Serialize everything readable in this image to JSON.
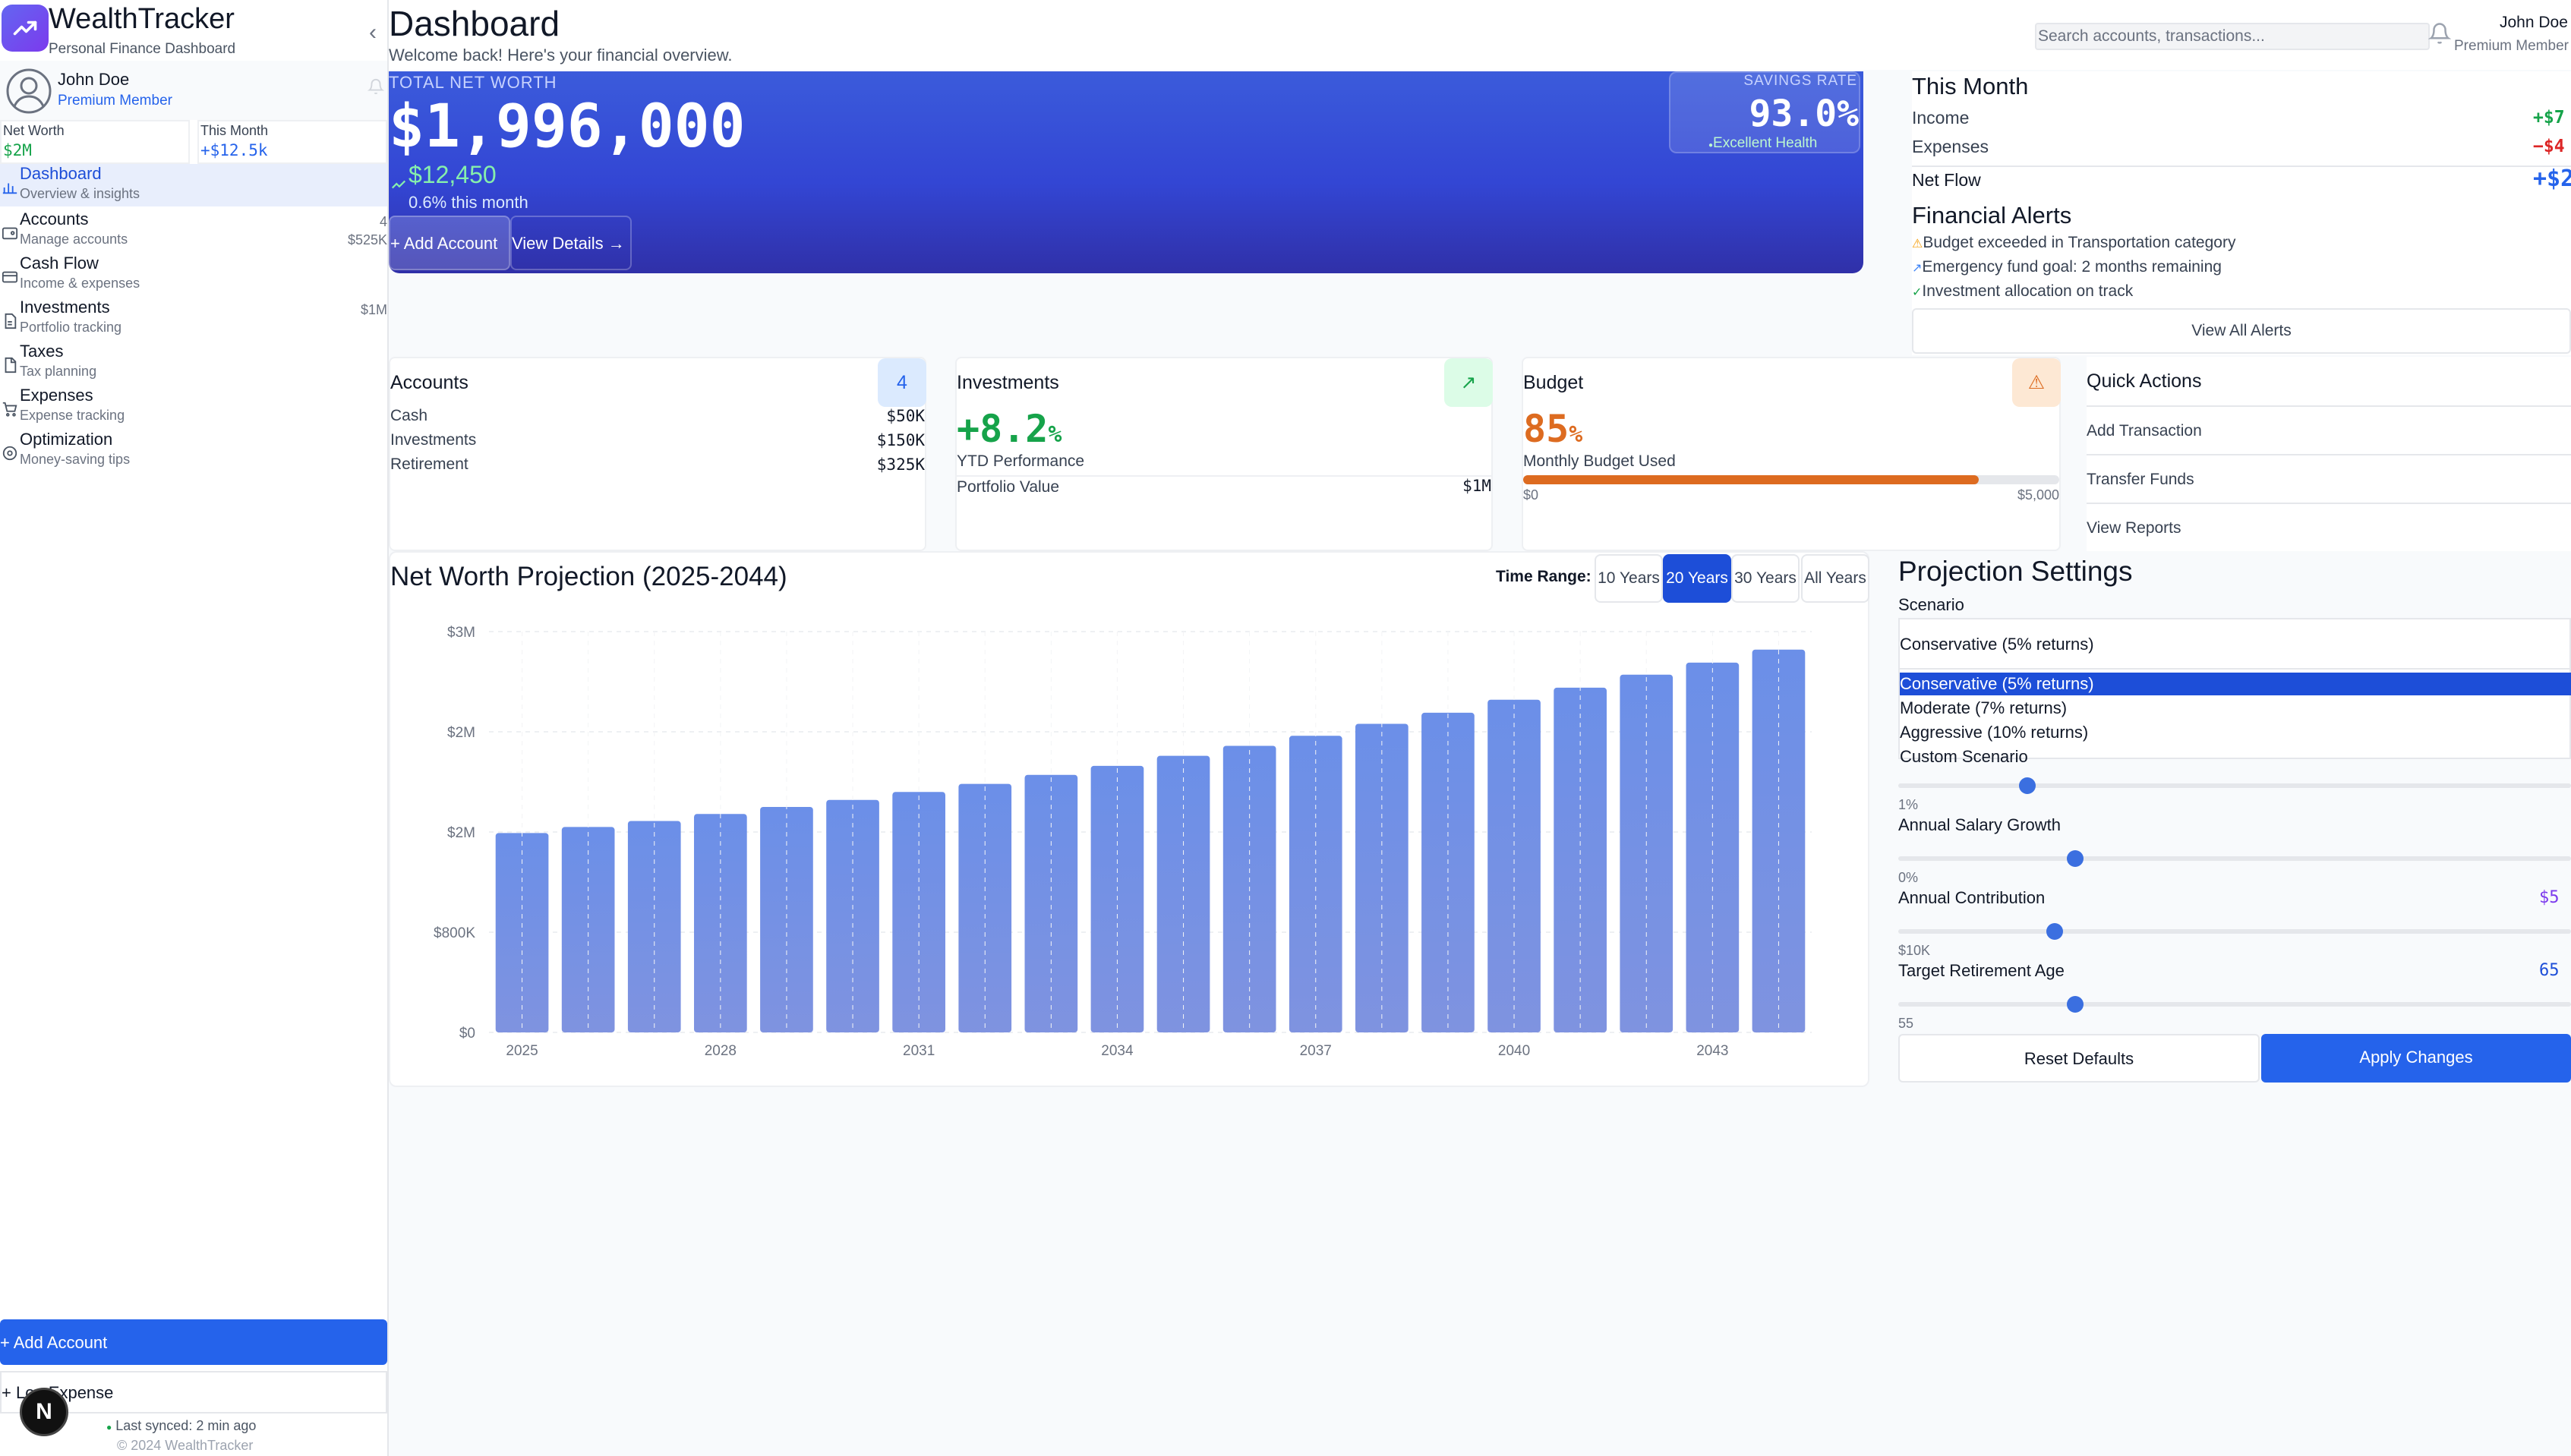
{
  "app": {
    "name": "WealthTracker",
    "tagline": "Personal Finance Dashboard"
  },
  "user": {
    "name": "John Doe",
    "membership": "Premium Member",
    "top_name": "John Doe",
    "top_membership": "Premium Member"
  },
  "sidebar": {
    "summary": [
      {
        "label": "Net Worth",
        "value": "$2M"
      },
      {
        "label": "This Month",
        "value": "+$12.5k"
      }
    ],
    "items": [
      {
        "label": "Dashboard",
        "sub": "Overview & insights",
        "count": "",
        "amount": "",
        "icon": "bar-chart-icon"
      },
      {
        "label": "Accounts",
        "sub": "Manage accounts",
        "count": "4",
        "amount": "$525K",
        "icon": "wallet-icon"
      },
      {
        "label": "Cash Flow",
        "sub": "Income & expenses",
        "count": "",
        "amount": "",
        "icon": "credit-card-icon"
      },
      {
        "label": "Investments",
        "sub": "Portfolio tracking",
        "count": "",
        "amount": "$1M",
        "icon": "document-icon"
      },
      {
        "label": "Taxes",
        "sub": "Tax planning",
        "count": "",
        "amount": "",
        "icon": "file-icon"
      },
      {
        "label": "Expenses",
        "sub": "Expense tracking",
        "count": "",
        "amount": "",
        "icon": "cart-icon"
      },
      {
        "label": "Optimization",
        "sub": "Money-saving tips",
        "count": "",
        "amount": "",
        "icon": "target-icon"
      }
    ],
    "add_account": "+ Add Account",
    "log_expense": "+ Log Expense",
    "last_synced": "Last synced: 2 min ago",
    "copyright": "© 2024 WealthTracker",
    "badge_letter": "N"
  },
  "header": {
    "title": "Dashboard",
    "subtitle": "Welcome back! Here's your financial overview.",
    "search_placeholder": "Search accounts, transactions..."
  },
  "hero": {
    "label": "TOTAL NET WORTH",
    "value": "$1,996,000",
    "change": "$12,450",
    "change_pct": "0.6% this month",
    "add_account": "+ Add Account",
    "view_details": "View Details",
    "savings_label": "SAVINGS RATE",
    "savings_value": "93.0%",
    "savings_health": "Excellent Health"
  },
  "this_month": {
    "title": "This Month",
    "rows": [
      {
        "label": "Income",
        "value": "+$7",
        "color": "#16a34a"
      },
      {
        "label": "Expenses",
        "value": "−$4",
        "color": "#dc2626"
      },
      {
        "label": "Net Flow",
        "value": "+$2,",
        "color": "#2563eb"
      }
    ]
  },
  "alerts": {
    "title": "Financial Alerts",
    "items": [
      {
        "text": "Budget exceeded in Transportation category",
        "icon": "warning-icon",
        "color": "#f59e0b"
      },
      {
        "text": "Emergency fund goal: 2 months remaining",
        "icon": "trend-icon",
        "color": "#3b82f6"
      },
      {
        "text": "Investment allocation on track",
        "icon": "check-circle-icon",
        "color": "#16a34a"
      }
    ],
    "view_all": "View All Alerts"
  },
  "cards": {
    "accounts": {
      "title": "Accounts",
      "badge": "4",
      "rows": [
        {
          "label": "Cash",
          "value": "$50K"
        },
        {
          "label": "Investments",
          "value": "$150K"
        },
        {
          "label": "Retirement",
          "value": "$325K"
        }
      ]
    },
    "investments": {
      "title": "Investments",
      "big": "+8.2",
      "big_suffix": "%",
      "caption": "YTD Performance",
      "row_label": "Portfolio Value",
      "row_value": "$1M"
    },
    "budget": {
      "title": "Budget",
      "big": "85",
      "big_suffix": "%",
      "caption": "Monthly Budget Used",
      "progress": 0.85,
      "min": "$0",
      "max": "$5,000"
    }
  },
  "quick_actions": {
    "title": "Quick Actions",
    "items": [
      "Add Transaction",
      "Transfer Funds",
      "View Reports"
    ]
  },
  "projection": {
    "title": "Net Worth Projection (2025-2044)",
    "time_range_label": "Time Range:",
    "ranges": [
      "10 Years",
      "20 Years",
      "30 Years",
      "All Years"
    ],
    "active_range": "20 Years"
  },
  "chart_data": {
    "type": "bar",
    "categories": [
      "2025",
      "2026",
      "2027",
      "2028",
      "2029",
      "2030",
      "2031",
      "2032",
      "2033",
      "2034",
      "2035",
      "2036",
      "2037",
      "2038",
      "2039",
      "2040",
      "2041",
      "2042",
      "2043",
      "2044"
    ],
    "values": [
      1990000,
      2050000,
      2110000,
      2180000,
      2250000,
      2320000,
      2400000,
      2480000,
      2570000,
      2660000,
      2760000,
      2860000,
      2960000,
      3080000,
      3190000,
      3320000,
      3440000,
      3570000,
      3690000,
      3820000
    ],
    "x_tick_labels": [
      "2025",
      "2028",
      "2031",
      "2034",
      "2037",
      "2040",
      "2043"
    ],
    "y_ticks": [
      {
        "value": 0,
        "label": "$0"
      },
      {
        "value": 1000000,
        "label": "$800K"
      },
      {
        "value": 2000000,
        "label": "$2M"
      },
      {
        "value": 3000000,
        "label": "$2M"
      },
      {
        "value": 4000000,
        "label": "$3M"
      }
    ],
    "ylim": [
      0,
      4000000
    ],
    "grid": true,
    "bar_color": "#6b8fe8"
  },
  "settings": {
    "title": "Projection Settings",
    "scenario_label": "Scenario",
    "scenario_selected": "Conservative (5% returns)",
    "scenario_options": [
      "Conservative (5% returns)",
      "Moderate (7% returns)",
      "Aggressive (10% returns)",
      "Custom Scenario"
    ],
    "sliders": [
      {
        "label": "",
        "min_label": "1%",
        "value_text": "",
        "value_color": "#2563eb",
        "position": 0.18
      },
      {
        "label": "Annual Salary Growth",
        "min_label": "0%",
        "value_text": "",
        "value_color": "#2563eb",
        "position": 0.25
      },
      {
        "label": "Annual Contribution",
        "min_label": "$10K",
        "value_text": "$5",
        "value_color": "#7c3aed",
        "position": 0.22
      },
      {
        "label": "Target Retirement Age",
        "min_label": "55",
        "value_text": "65",
        "value_color": "#1d4ed8",
        "position": 0.25
      }
    ],
    "reset": "Reset Defaults",
    "apply": "Apply Changes"
  }
}
